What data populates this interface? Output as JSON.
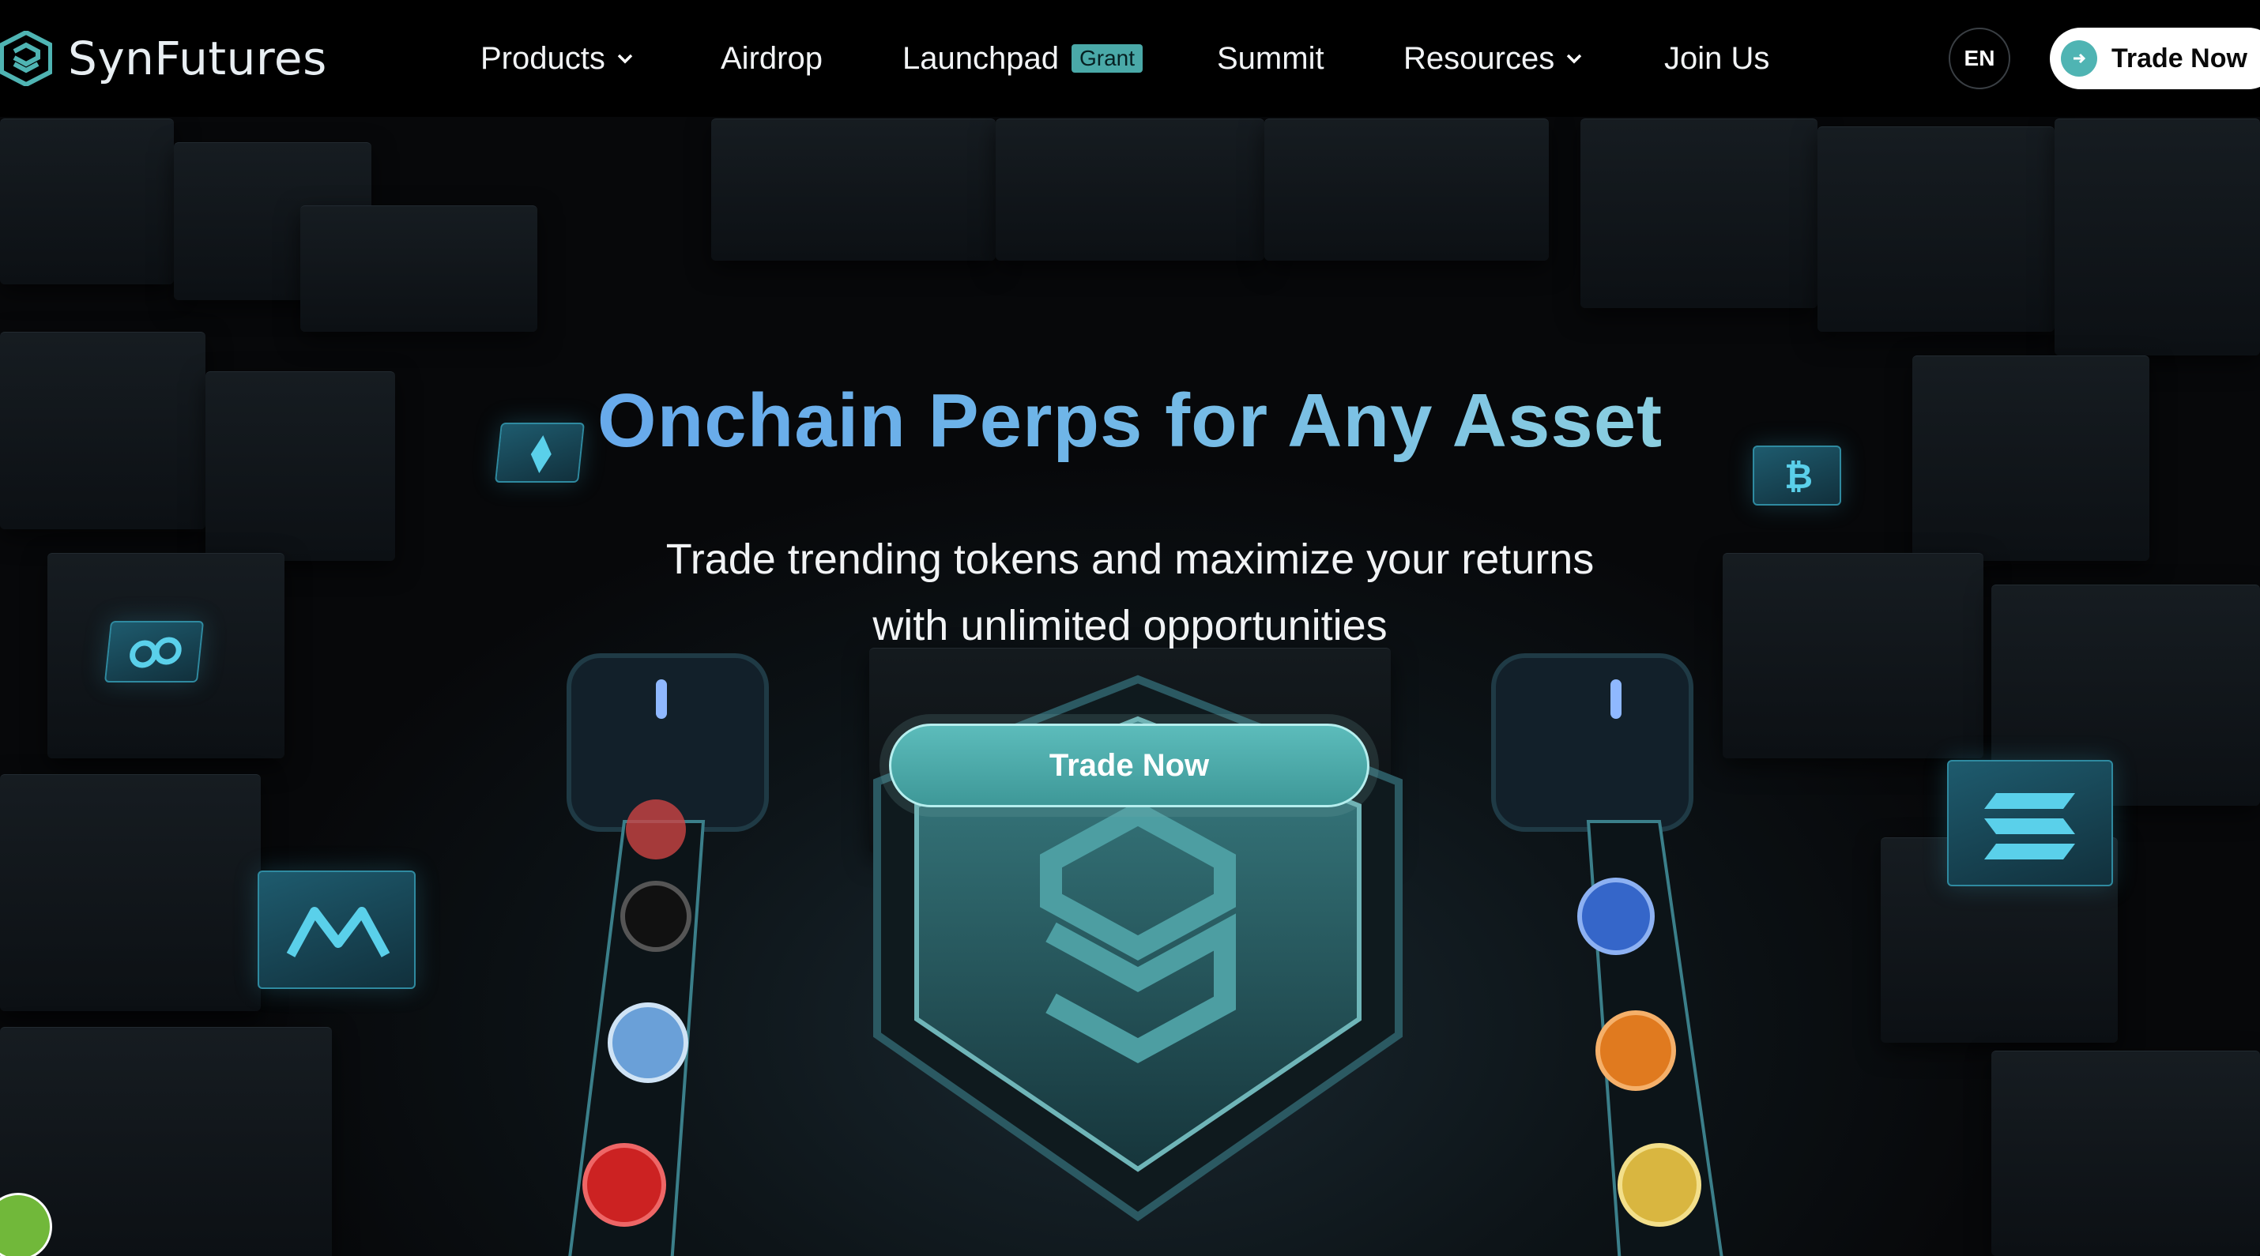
{
  "brand": {
    "name": "SynFutures"
  },
  "nav": {
    "items": [
      {
        "label": "Products",
        "has_dropdown": true
      },
      {
        "label": "Airdrop",
        "has_dropdown": false
      },
      {
        "label": "Launchpad",
        "badge": "Grant",
        "has_dropdown": false
      },
      {
        "label": "Summit",
        "has_dropdown": false
      },
      {
        "label": "Resources",
        "has_dropdown": true
      },
      {
        "label": "Join Us",
        "has_dropdown": false
      }
    ],
    "language": "EN",
    "cta_label": "Trade Now"
  },
  "hero": {
    "title": "Onchain Perps for Any Asset",
    "subtitle_line1": "Trade trending tokens and maximize your returns",
    "subtitle_line2": "with unlimited opportunities",
    "cta_label": "Trade Now"
  },
  "colors": {
    "accent": "#4fb4b3",
    "title_gradient_start": "#5f9cf0",
    "title_gradient_end": "#a5e8d8",
    "background": "#07080a"
  },
  "icons": [
    "synfutures-logo-icon",
    "chevron-down-icon",
    "arrow-right-icon",
    "ethereum-icon",
    "bitcoin-icon",
    "polygon-icon",
    "axie-icon",
    "solana-icon",
    "cookie-icon"
  ]
}
